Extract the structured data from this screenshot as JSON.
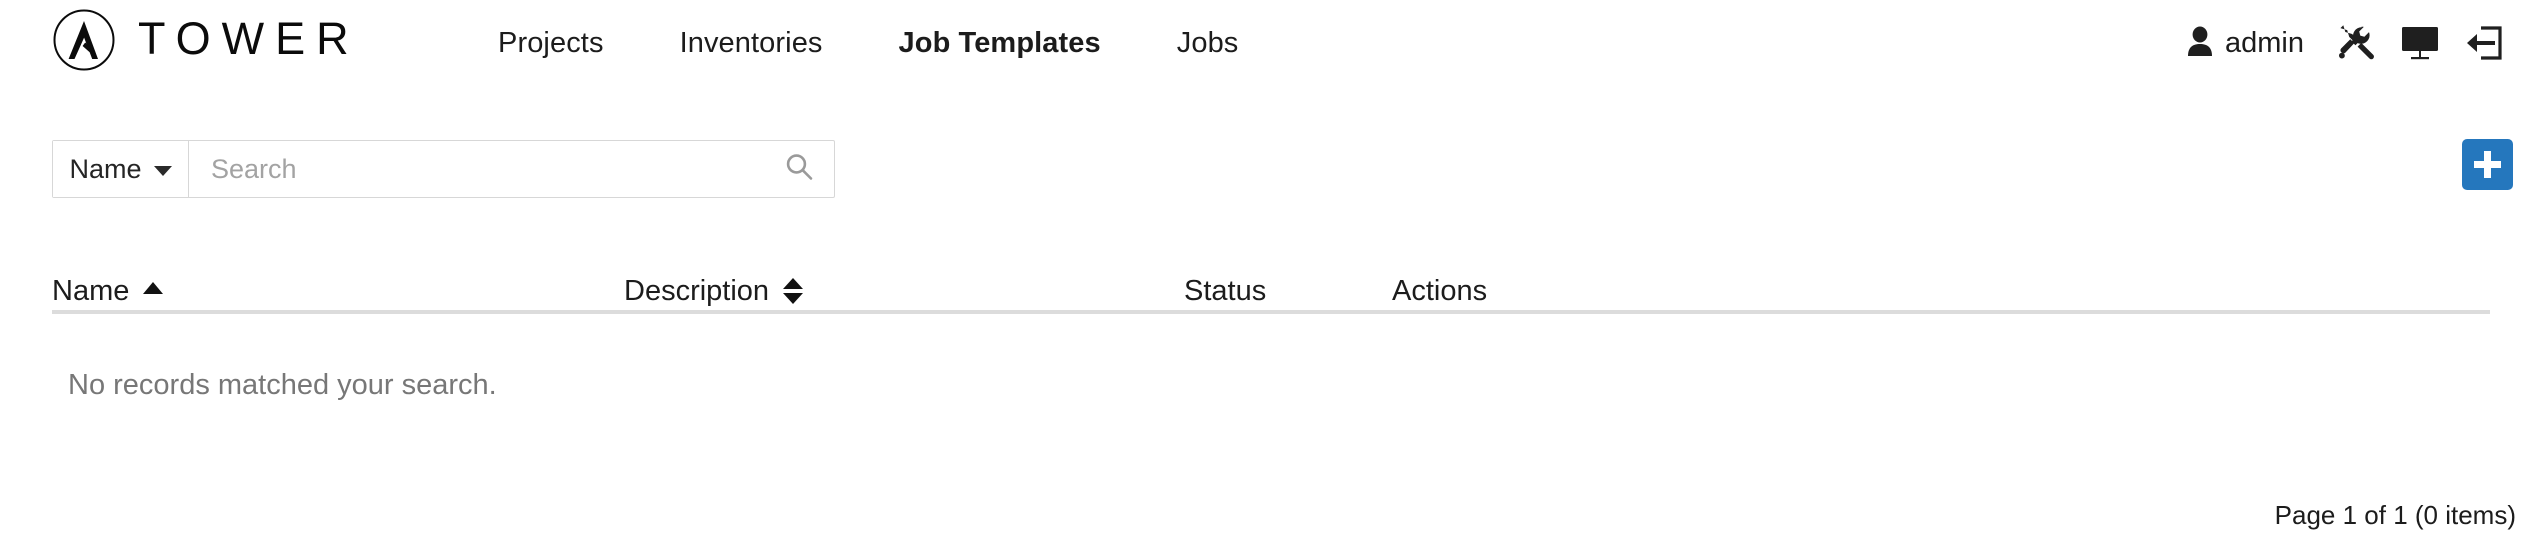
{
  "header": {
    "brand": {
      "logo_icon": "ansible-a-logo-icon",
      "wordmark": "TOWER"
    },
    "nav": [
      {
        "label": "Projects",
        "active": false
      },
      {
        "label": "Inventories",
        "active": false
      },
      {
        "label": "Job Templates",
        "active": true
      },
      {
        "label": "Jobs",
        "active": false
      }
    ],
    "user": {
      "icon": "user-icon",
      "name": "admin"
    },
    "actions": [
      {
        "icon": "wrench-screwdriver-icon",
        "name": "settings"
      },
      {
        "icon": "monitor-icon",
        "name": "view-dashboard"
      },
      {
        "icon": "logout-arrow-icon",
        "name": "logout"
      }
    ]
  },
  "toolbar": {
    "search_key": {
      "label": "Name",
      "caret_icon": "chevron-down-icon"
    },
    "search": {
      "value": "",
      "placeholder": "Search",
      "submit_icon": "search-icon"
    },
    "add_button": {
      "label": "+",
      "icon": "plus-icon",
      "color": "#2577bd"
    }
  },
  "table": {
    "columns": [
      {
        "label": "Name",
        "sort": "asc",
        "sortable": true
      },
      {
        "label": "Description",
        "sort": "both",
        "sortable": true
      },
      {
        "label": "Status",
        "sort": "none",
        "sortable": false
      },
      {
        "label": "Actions",
        "sort": "none",
        "sortable": false
      }
    ],
    "rows": [],
    "empty_message": "No records matched your search."
  },
  "pagination": {
    "status": "Page 1 of 1 (0 items)"
  },
  "colors": {
    "accent": "#2577bd",
    "text": "#1c1c1c",
    "muted": "#777777",
    "placeholder": "#a3a3a3",
    "border": "#d7d7d7",
    "rule": "#dcdcdc"
  }
}
